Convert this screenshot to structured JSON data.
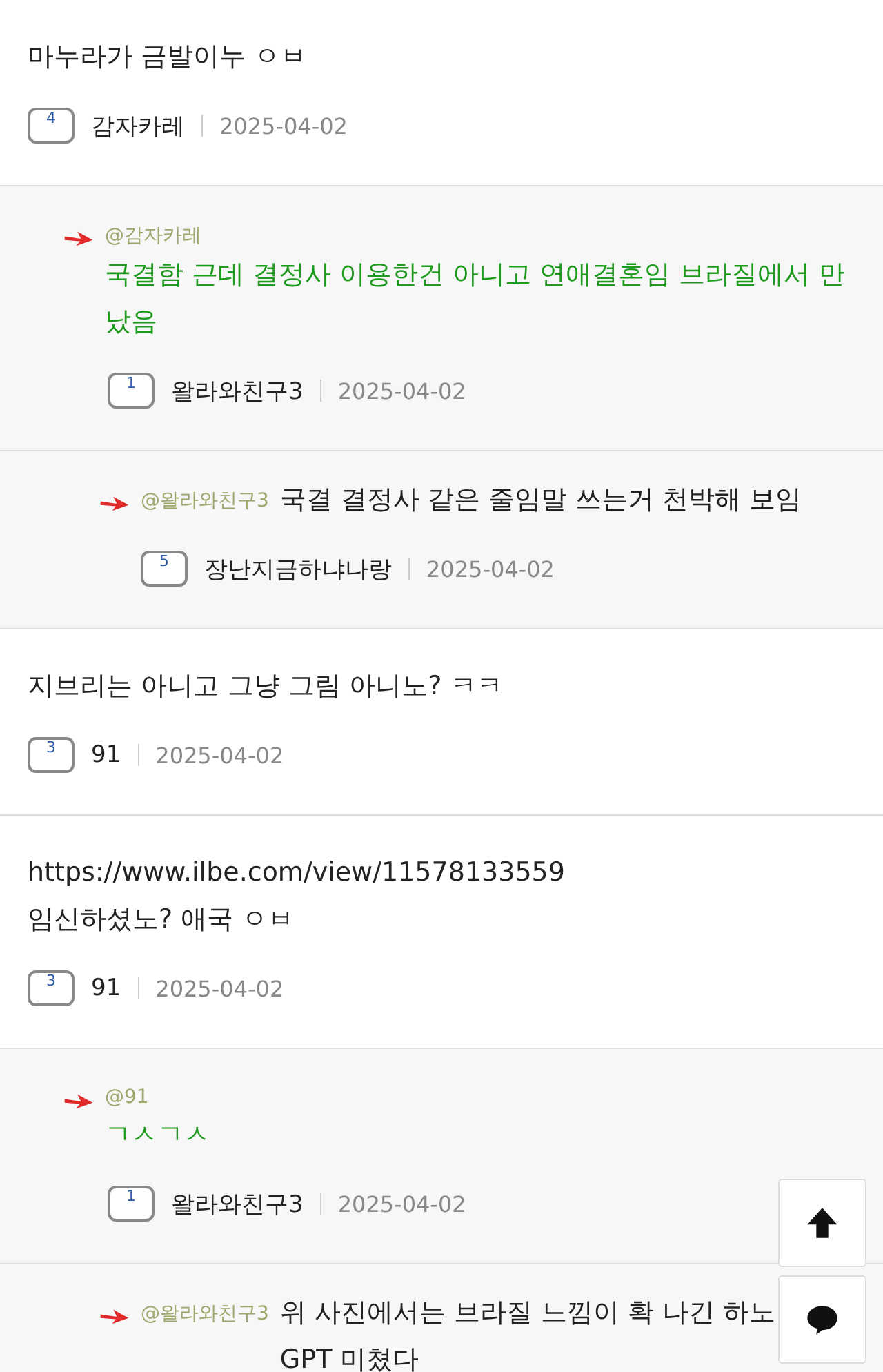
{
  "comments": [
    {
      "text": "마누라가 금발이누 ㅇㅂ",
      "highlighted": false,
      "level": "4",
      "author": "감자카레",
      "date": "2025-04-02",
      "children": [
        {
          "mention": "@감자카레",
          "text": "국결함 근데 결정사 이용한건 아니고 연애결혼임 브라질에서 만났음",
          "highlighted": true,
          "level": "1",
          "author": "왈라와친구3",
          "date": "2025-04-02",
          "children": [
            {
              "mention": "@왈라와친구3",
              "text": "국결 결정사 같은 줄임말 쓰는거 천박해 보임",
              "highlighted": false,
              "level": "5",
              "author": "장난지금하냐나랑",
              "date": "2025-04-02"
            }
          ]
        }
      ]
    },
    {
      "text": "지브리는 아니고 그냥 그림 아니노? ㅋㅋ",
      "highlighted": false,
      "level": "3",
      "author": "91",
      "date": "2025-04-02"
    },
    {
      "text": "https://www.ilbe.com/view/11578133559\n임신하셨노? 애국 ㅇㅂ",
      "highlighted": false,
      "level": "3",
      "author": "91",
      "date": "2025-04-02",
      "children": [
        {
          "mention": "@91",
          "text": "ㄱㅅㄱㅅ",
          "highlighted": true,
          "level": "1",
          "author": "왈라와친구3",
          "date": "2025-04-02",
          "children": [
            {
              "mention": "@왈라와친구3",
              "text": "위 사진에서는 브라질 느낌이 확 나긴 하노\nGPT 미쳤다",
              "highlighted": false
            }
          ]
        }
      ]
    }
  ],
  "floating_buttons": [
    {
      "kind": "top"
    },
    {
      "kind": "comment"
    }
  ]
}
